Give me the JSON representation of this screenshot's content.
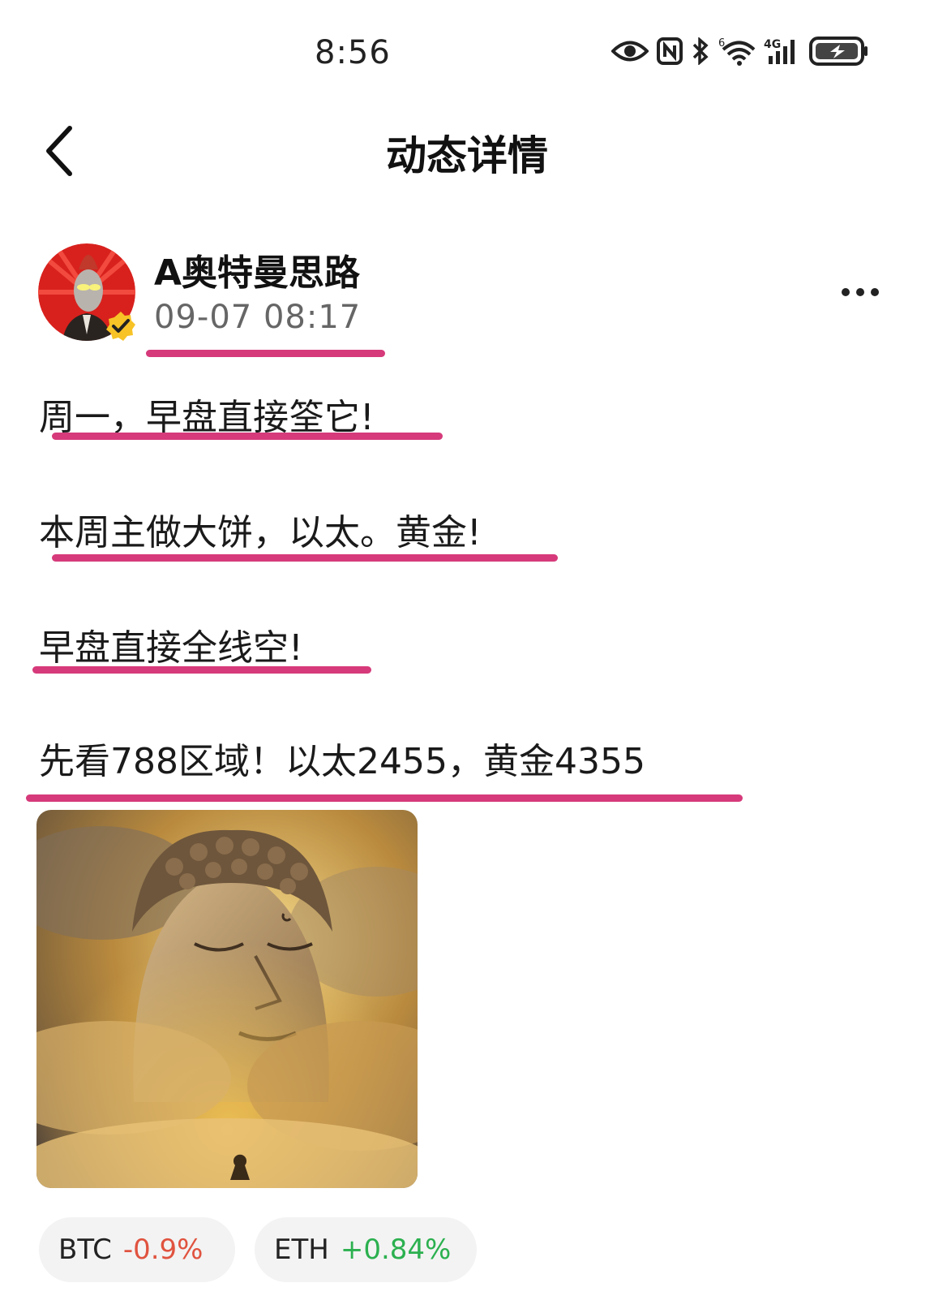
{
  "status_bar": {
    "time": "8:56",
    "network_label": "4G",
    "wifi_label": "6"
  },
  "nav": {
    "title": "动态详情"
  },
  "author": {
    "name": "A奥特曼思路",
    "time": "09-07 08:17"
  },
  "post": {
    "lines": [
      "周一，早盘直接筌它!",
      "本周主做大饼，以太。黄金!",
      "早盘直接全线空!",
      "先看788区域！以太2455，黄金4355"
    ]
  },
  "tags": [
    {
      "symbol": "BTC",
      "change": "-0.9%"
    },
    {
      "symbol": "ETH",
      "change": "+0.84%"
    }
  ],
  "colors": {
    "highlight": "#d63a7a",
    "negative": "#e0533f",
    "positive": "#2bb04f"
  },
  "icons": [
    "eye-icon",
    "nfc-icon",
    "bluetooth-icon",
    "wifi-icon",
    "signal-icon",
    "battery-charging-icon",
    "back-arrow-icon",
    "more-icon",
    "verified-icon"
  ]
}
